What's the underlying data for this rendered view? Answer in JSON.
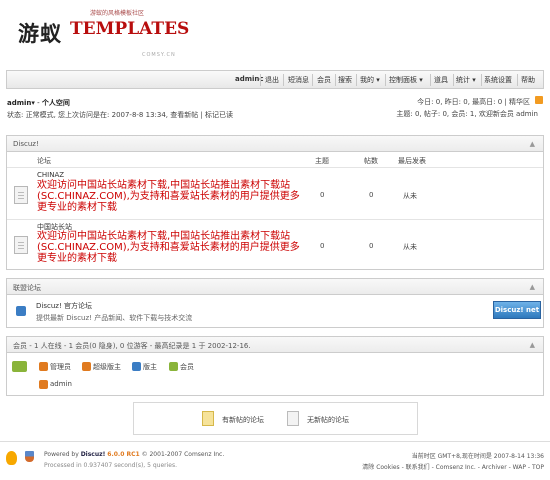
{
  "header": {
    "logo_cn": "游蚁",
    "logo_en": "TEMPLATES",
    "tagline": "游蚁的风格模板社区",
    "subsite": "COMSY.CN"
  },
  "nav": {
    "items": [
      {
        "label": "adminc",
        "bold": true
      },
      {
        "label": "退出"
      },
      {
        "label": "短消息"
      },
      {
        "label": "会员"
      },
      {
        "label": "搜索"
      },
      {
        "label": "我的 ▾"
      },
      {
        "label": "控制面板 ▾"
      },
      {
        "label": "道具"
      },
      {
        "label": "统计 ▾"
      },
      {
        "label": "系统设置"
      },
      {
        "label": "帮助"
      }
    ]
  },
  "userbar": {
    "username": "admin",
    "space_link": "个人空间",
    "status_line": "状态: 正常模式, 您上次访问是在: 2007-8-8 13:34, 查看新帖 | 标记已读",
    "stats_right1": "今日: 0, 昨日: 0, 最高日: 0 | 精华区",
    "stats_right2": "主题: 0, 帖子: 0, 会员: 1, 欢迎新会员 admin"
  },
  "forum_box": {
    "title": "Discuz!",
    "columns": {
      "forum": "论坛",
      "topics": "主题",
      "posts": "帖数",
      "last": "最后发表"
    },
    "rows": [
      {
        "name": "CHINAZ",
        "desc": "欢迎访问中国站长站素材下载,中国站长站推出素材下载站(SC.CHINAZ.COM),为支持和喜爱站长素材的用户提供更多更专业的素材下载",
        "topics": "0",
        "posts": "0",
        "last": "从未"
      },
      {
        "name": "中国站长站",
        "desc": "欢迎访问中国站长站素材下载,中国站长站推出素材下载站(SC.CHINAZ.COM),为支持和喜爱站长素材的用户提供更多更专业的素材下载",
        "topics": "0",
        "posts": "0",
        "last": "从未"
      }
    ]
  },
  "league_box": {
    "title": "联盟论坛",
    "name": "Discuz! 官方论坛",
    "desc": "提供最新 Discuz! 产品新闻、软件下载与技术交流",
    "badge": "Discuz! net"
  },
  "online_box": {
    "title": "会员 - 1 人在线 - 1 会员(0 隐身), 0 位游客 - 最高纪录是 1 于 2002-12-16.",
    "groups": [
      {
        "label": "管理员",
        "color": "#e07a1f"
      },
      {
        "label": "超级版主",
        "color": "#e07a1f"
      },
      {
        "label": "版主",
        "color": "#3b7dc4"
      },
      {
        "label": "会员",
        "color": "#8ab43a"
      }
    ],
    "online_user": "admin"
  },
  "legend": {
    "new": "有新帖的论坛",
    "none": "无新帖的论坛"
  },
  "footer": {
    "powered_prefix": "Powered by ",
    "product": "Discuz!",
    "version": "6.0.0 RC1",
    "copyright": "© 2001-2007 Comsenz Inc.",
    "processed": "Processed in 0.937407 second(s), 5 queries.",
    "time_line": "当前时区 GMT+8,现在时间是 2007-8-14 13:36",
    "links": "清除 Cookies - 联系我们 - Comsenz Inc. - Archiver - WAP - TOP"
  },
  "colors": {
    "accent_red": "#cc0000",
    "logo_red": "#b80d0d"
  }
}
